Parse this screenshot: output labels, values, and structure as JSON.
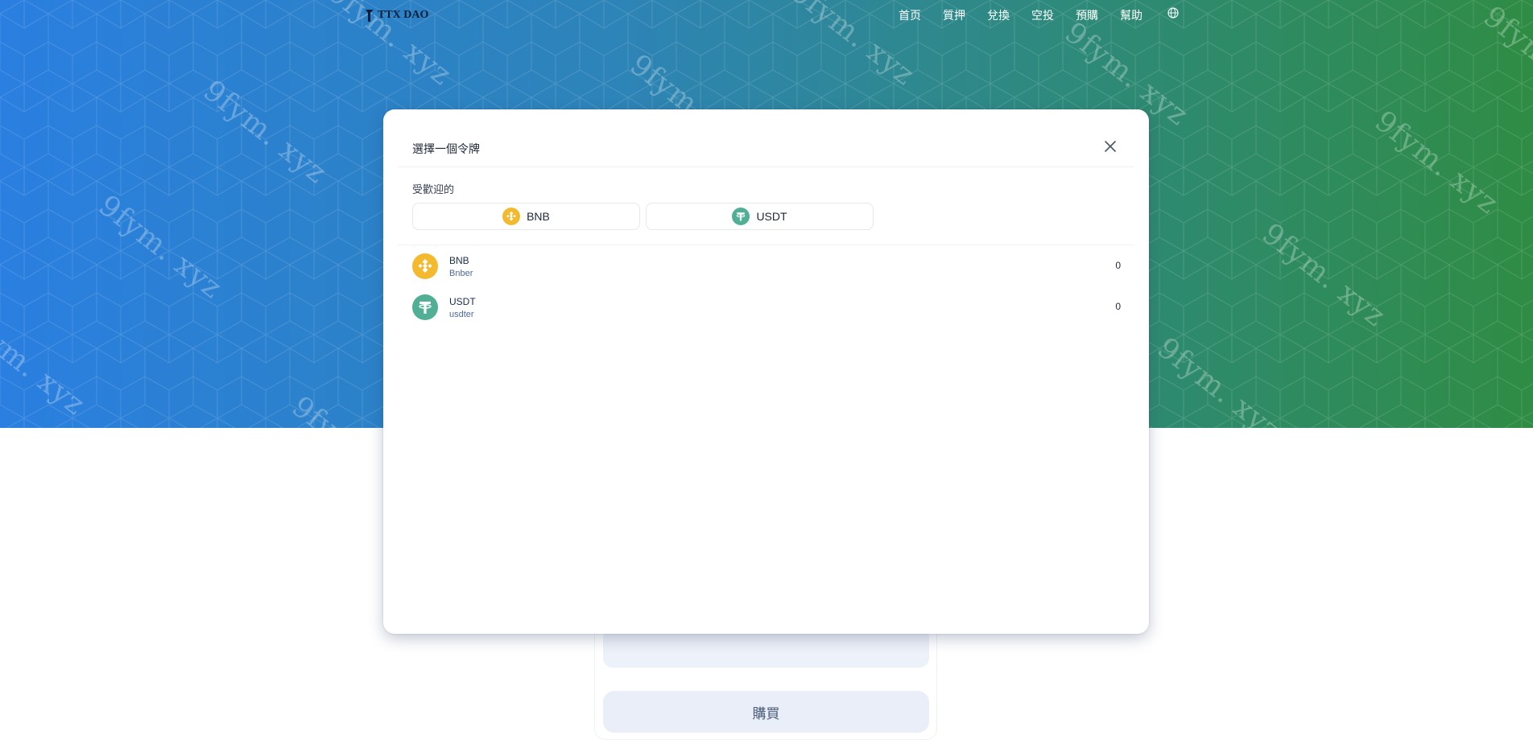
{
  "brand": {
    "name": "TTX DAO"
  },
  "nav": {
    "items": [
      "首页",
      "質押",
      "兌換",
      "空投",
      "預購",
      "幫助"
    ],
    "lang": "🌐"
  },
  "watermark": {
    "text": "9fym. xyz"
  },
  "modal": {
    "title": "選擇一個令牌",
    "popular_label": "受歡迎的",
    "popular_tokens": [
      "BNB",
      "USDT"
    ],
    "tokens": [
      {
        "symbol": "BNB",
        "name": "Bnber",
        "balance": "0"
      },
      {
        "symbol": "USDT",
        "name": "usdter",
        "balance": "0"
      }
    ]
  },
  "page": {
    "buy_label": "購買"
  },
  "colors": {
    "bnb": "#F3BA2F",
    "usdt": "#50AF95",
    "hero_start": "#2a7fe0",
    "hero_end": "#2f8c44"
  }
}
